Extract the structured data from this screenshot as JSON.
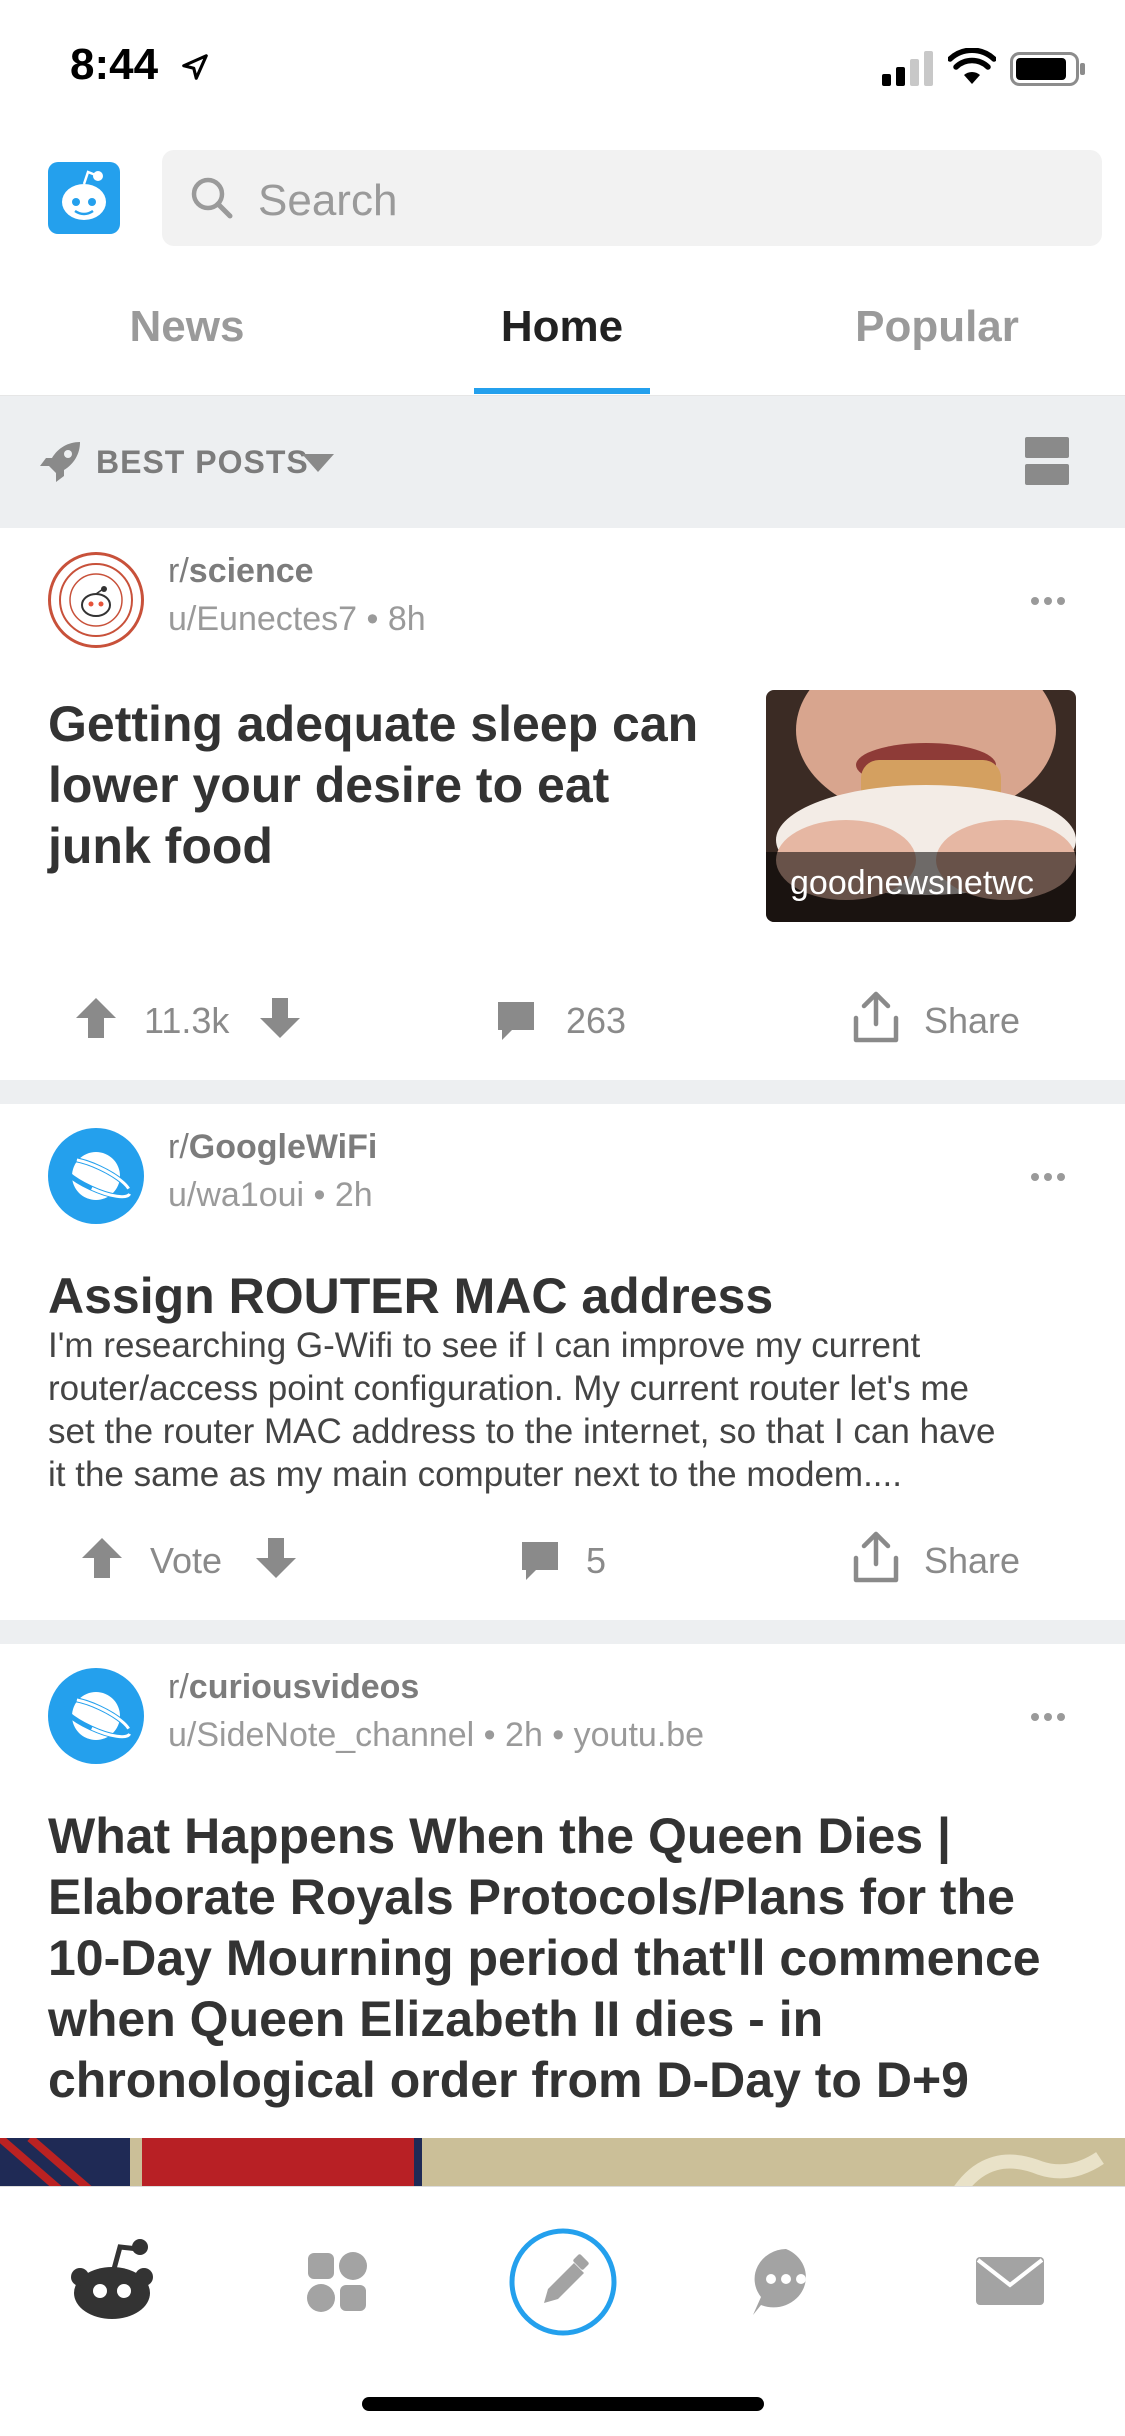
{
  "status_bar": {
    "time": "8:44"
  },
  "header": {
    "search_placeholder": "Search"
  },
  "tabs": [
    {
      "label": "News",
      "active": false
    },
    {
      "label": "Home",
      "active": true
    },
    {
      "label": "Popular",
      "active": false
    }
  ],
  "sort": {
    "label": "BEST POSTS"
  },
  "posts": [
    {
      "subreddit_prefix": "r/",
      "subreddit": "science",
      "meta": "u/Eunectes7 • 8h",
      "title_lines": [
        "Getting adequate sleep can",
        "lower your desire to eat",
        "junk food"
      ],
      "thumbnail_caption": "goodnewsnetwc",
      "score": "11.3k",
      "comments": "263",
      "share": "Share"
    },
    {
      "subreddit_prefix": "r/",
      "subreddit": "GoogleWiFi",
      "meta": "u/wa1oui • 2h",
      "title_lines": [
        "Assign ROUTER MAC address"
      ],
      "body_lines": [
        "I'm researching G-Wifi to see if I can improve my current",
        "router/access point configuration. My current router let's me",
        "set the router MAC address to the internet, so that I can have",
        "it the same as my main computer next to the modem...."
      ],
      "score": "Vote",
      "comments": "5",
      "share": "Share"
    },
    {
      "subreddit_prefix": "r/",
      "subreddit": "curiousvideos",
      "meta": "u/SideNote_channel • 2h • youtu.be",
      "title_lines": [
        "What Happens When the Queen Dies |",
        "Elaborate Royals Protocols/Plans for the",
        "10-Day Mourning period that'll commence",
        "when Queen Elizabeth II dies - in",
        "chronological order from D-Day to D+9"
      ]
    }
  ],
  "colors": {
    "accent": "#24a0ed",
    "icon_gray": "#8a8a8a",
    "background_gray": "#edeff1"
  }
}
